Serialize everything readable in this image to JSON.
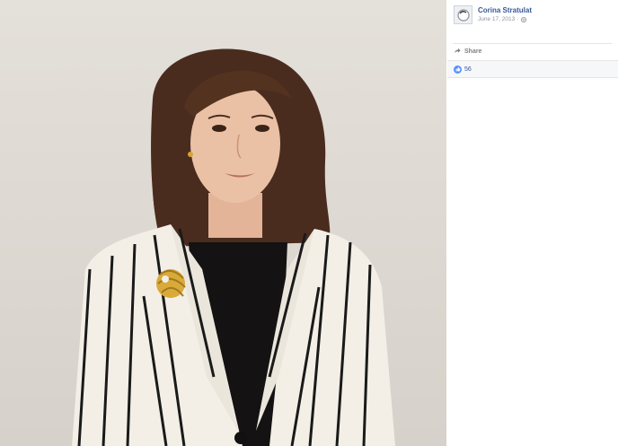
{
  "post": {
    "author": "Corina Stratulat",
    "date": "June 17, 2013 ·",
    "privacy_icon": "globe-icon"
  },
  "actions": {
    "share_label": "Share",
    "share_icon": "share-arrow-icon"
  },
  "reactions": {
    "icon": "like-thumb-icon",
    "count": "56"
  },
  "colors": {
    "link_blue": "#365899",
    "like_blue": "#5890ff",
    "meta_gray": "#90949c"
  }
}
